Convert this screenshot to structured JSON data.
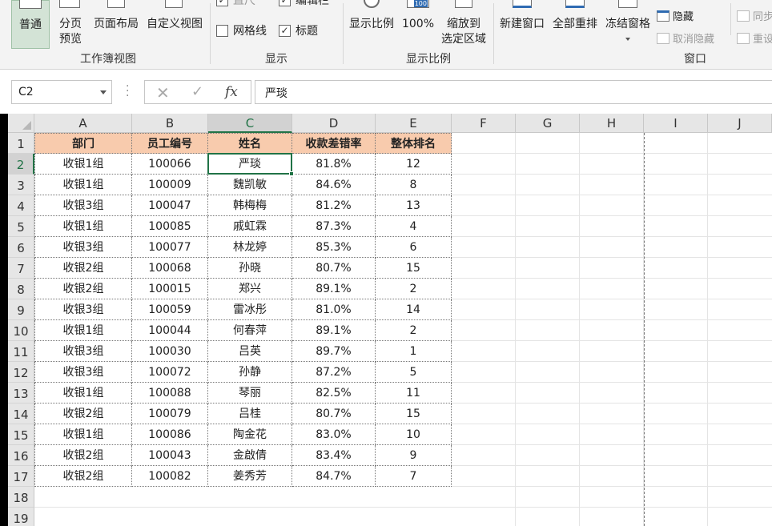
{
  "ribbon": {
    "views": {
      "normal": "普通",
      "page_break_1": "分页",
      "page_break_2": "预览",
      "page_layout": "页面布局",
      "custom_views": "自定义视图",
      "group_label": "工作簿视图"
    },
    "show": {
      "ruler": "直尺",
      "formula_bar": "编辑栏",
      "gridlines": "网格线",
      "gridlines_checked": false,
      "headings": "标题",
      "headings_checked": true,
      "group_label": "显示"
    },
    "zoom": {
      "zoom": "显示比例",
      "zoom_100": "100%",
      "zoom_100_icon_text": "100",
      "zoom_sel_1": "缩放到",
      "zoom_sel_2": "选定区域",
      "group_label": "显示比例"
    },
    "window": {
      "new_window": "新建窗口",
      "arrange_all": "全部重排",
      "freeze_panes": "冻结窗格",
      "hide": "隐藏",
      "unhide": "取消隐藏",
      "side_by_side": "同步",
      "reset_position": "重设",
      "group_label": "窗口"
    }
  },
  "formula_bar": {
    "name_box": "C2",
    "cancel_symbol": "✕",
    "enter_symbol": "✓",
    "fx_symbol": "fx",
    "formula": "严琰"
  },
  "sheet": {
    "columns": [
      "A",
      "B",
      "C",
      "D",
      "E",
      "F",
      "G",
      "H",
      "I",
      "J"
    ],
    "selected_column": "C",
    "selected_row": 2,
    "row_numbers": [
      1,
      2,
      3,
      4,
      5,
      6,
      7,
      8,
      9,
      10,
      11,
      12,
      13,
      14,
      15,
      16,
      17,
      18,
      19
    ],
    "headers": [
      "部门",
      "员工编号",
      "姓名",
      "收款差错率",
      "整体排名"
    ],
    "rows": [
      [
        "收银1组",
        "100066",
        "严琰",
        "81.8%",
        "12"
      ],
      [
        "收银1组",
        "100009",
        "魏凯敏",
        "84.6%",
        "8"
      ],
      [
        "收银3组",
        "100047",
        "韩梅梅",
        "81.2%",
        "13"
      ],
      [
        "收银1组",
        "100085",
        "戚虹霖",
        "87.3%",
        "4"
      ],
      [
        "收银3组",
        "100077",
        "林龙婷",
        "85.3%",
        "6"
      ],
      [
        "收银2组",
        "100068",
        "孙晓",
        "80.7%",
        "15"
      ],
      [
        "收银2组",
        "100015",
        "郑兴",
        "89.1%",
        "2"
      ],
      [
        "收银3组",
        "100059",
        "雷冰彤",
        "81.0%",
        "14"
      ],
      [
        "收银1组",
        "100044",
        "何春萍",
        "89.1%",
        "2"
      ],
      [
        "收银3组",
        "100030",
        "吕英",
        "89.7%",
        "1"
      ],
      [
        "收银3组",
        "100072",
        "孙静",
        "87.2%",
        "5"
      ],
      [
        "收银1组",
        "100088",
        "琴丽",
        "82.5%",
        "11"
      ],
      [
        "收银2组",
        "100079",
        "吕桂",
        "80.7%",
        "15"
      ],
      [
        "收银1组",
        "100086",
        "陶金花",
        "83.0%",
        "10"
      ],
      [
        "收银2组",
        "100043",
        "金啟倩",
        "83.4%",
        "9"
      ],
      [
        "收银2组",
        "100082",
        "姜秀芳",
        "84.7%",
        "7"
      ]
    ]
  },
  "colors": {
    "header_fill": "#f8cbad",
    "accent": "#217346"
  }
}
